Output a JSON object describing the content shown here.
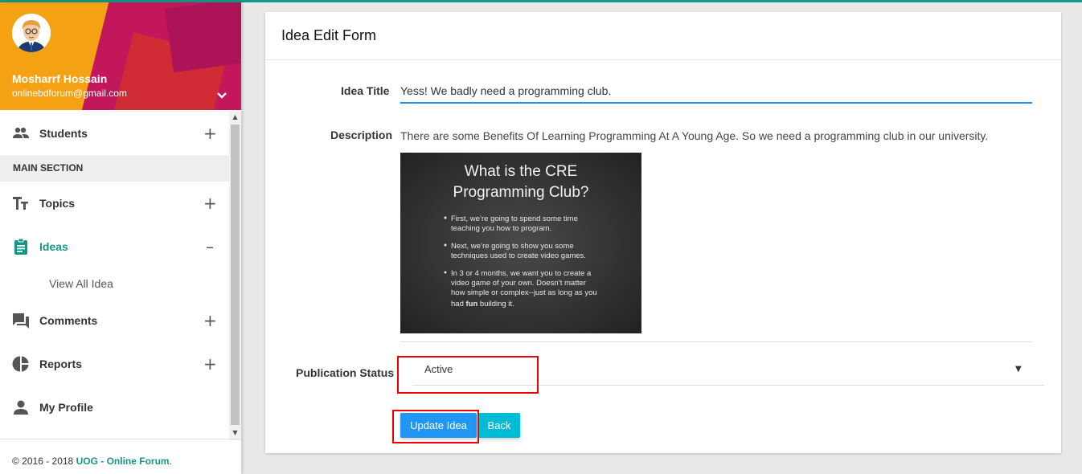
{
  "user": {
    "name": "Mosharrf Hossain",
    "email": "onlinebdforum@gmail.com"
  },
  "menu": {
    "students": "Students",
    "section_header": "MAIN SECTION",
    "topics": "Topics",
    "ideas": "Ideas",
    "view_all_idea": "View All Idea",
    "comments": "Comments",
    "reports": "Reports",
    "my_profile": "My Profile",
    "expand_symbol": "+",
    "collapse_symbol": "–"
  },
  "footer": {
    "copyright": "© 2016 - 2018 ",
    "brand": "UOG - Online Forum",
    "period": "."
  },
  "form": {
    "header": "Idea Edit Form",
    "title_label": "Idea Title",
    "title_value": "Yess! We badly need a programming club.",
    "description_label": "Description",
    "description_text": "There are some Benefits Of Learning Programming At A Young Age. So we need a programming club in our university.",
    "slide": {
      "heading_line1": "What is the CRE",
      "heading_line2": "Programming Club?",
      "bullets": [
        [
          "First, we’re going to spend some time",
          "teaching you how to program."
        ],
        [
          "Next, we’re going to show you some",
          "techniques used to create video games."
        ],
        [
          "In 3 or 4 months, we want you to create a",
          "video game of your own. Doesn’t matter",
          "how simple or complex--just as long as you"
        ]
      ],
      "last_line_pre": "had ",
      "last_line_bold": "fun",
      "last_line_post": " building it."
    },
    "status_label": "Publication Status",
    "status_value": "Active",
    "update_button": "Update Idea",
    "back_button": "Back"
  },
  "colors": {
    "accent": "#159686",
    "primary_button": "#2196f3",
    "back_button": "#00bcd4",
    "highlight": "#ee0000"
  }
}
